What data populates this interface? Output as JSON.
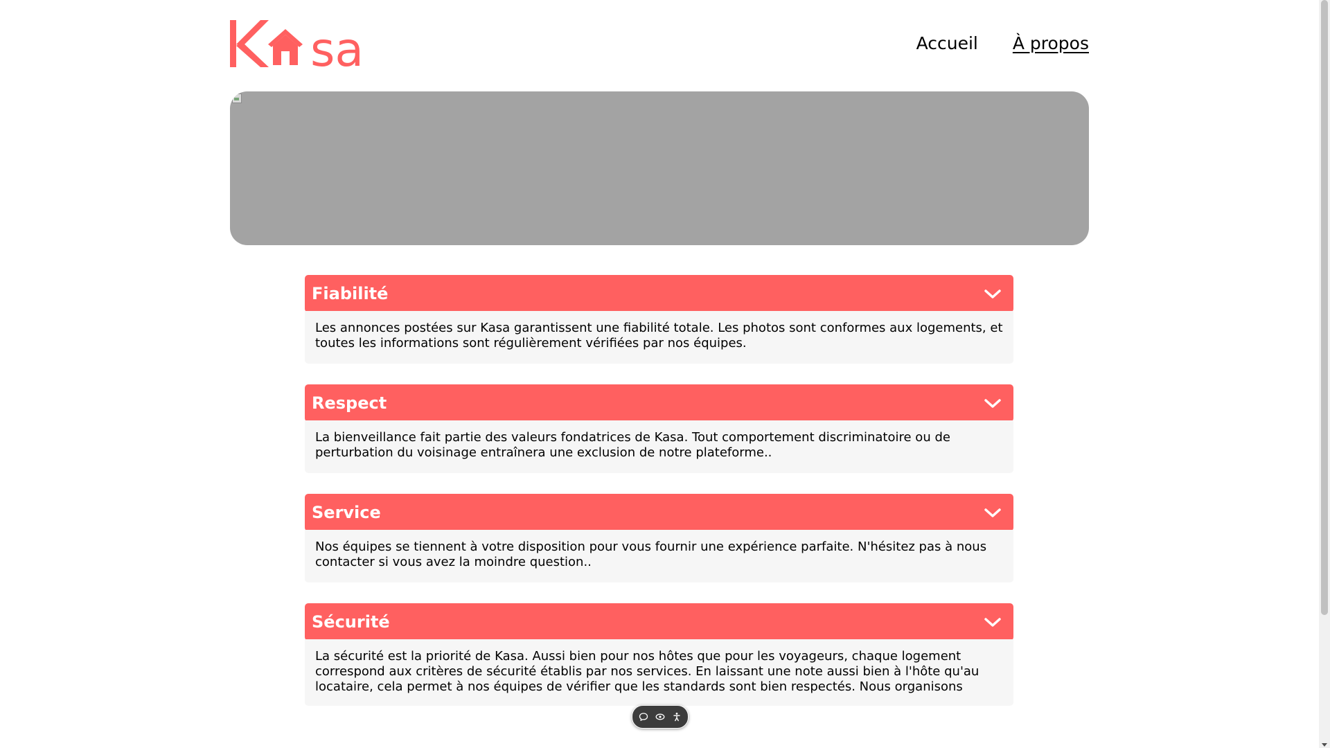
{
  "header": {
    "logo_text": "Kasa",
    "nav": [
      {
        "label": "Accueil",
        "active": false
      },
      {
        "label": "À propos",
        "active": true
      }
    ]
  },
  "colors": {
    "accent": "#ff6060",
    "panel": "#f6f6f6",
    "banner": "#a3a3a3"
  },
  "collapses": [
    {
      "title": "Fiabilité",
      "content": "Les annonces postées sur Kasa garantissent une fiabilité totale. Les photos sont conformes aux logements, et toutes les informations sont régulièrement vérifiées par nos équipes."
    },
    {
      "title": "Respect",
      "content": "La bienveillance fait partie des valeurs fondatrices de Kasa. Tout comportement discriminatoire ou de perturbation du voisinage entraînera une exclusion de notre plateforme.."
    },
    {
      "title": "Service",
      "content": "Nos équipes se tiennent à votre disposition pour vous fournir une expérience parfaite. N'hésitez pas à nous contacter si vous avez la moindre question.."
    },
    {
      "title": "Sécurité",
      "content": "La sécurité est la priorité de Kasa. Aussi bien pour nos hôtes que pour les voyageurs, chaque logement correspond aux critères de sécurité établis par nos services. En laissant une note aussi bien à l'hôte qu'au locataire, cela permet à nos équipes de vérifier que les standards sont bien respectés. Nous organisons"
    }
  ],
  "icons": {
    "collapse_toggle": "chevron-down-icon",
    "float_bar": [
      "comment-icon",
      "eye-icon",
      "accessibility-icon"
    ]
  }
}
